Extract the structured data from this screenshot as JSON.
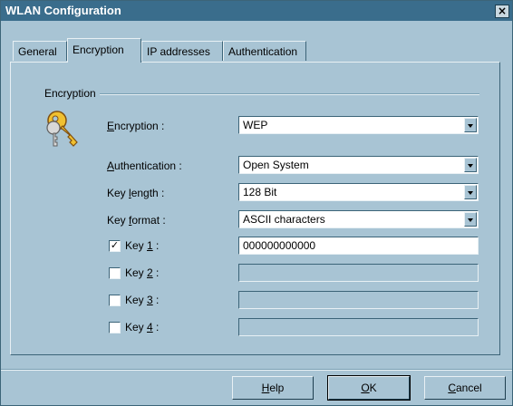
{
  "window": {
    "title": "WLAN Configuration",
    "close_glyph": "×"
  },
  "tabs": [
    {
      "label": "General",
      "active": false
    },
    {
      "label": "Encryption",
      "active": true
    },
    {
      "label": "IP addresses",
      "active": false
    },
    {
      "label": "Authentication",
      "active": false
    }
  ],
  "group": {
    "label": "Encryption",
    "icon": "keys-icon"
  },
  "fields": {
    "encryption": {
      "label_pre": "",
      "label_ul": "E",
      "label_post": "ncryption :",
      "value": "WEP"
    },
    "authentication": {
      "label_pre": "",
      "label_ul": "A",
      "label_post": "uthentication :",
      "value": "Open System"
    },
    "key_length": {
      "label_pre": "Key ",
      "label_ul": "l",
      "label_post": "ength :",
      "value": "128 Bit"
    },
    "key_format": {
      "label_pre": "Key ",
      "label_ul": "f",
      "label_post": "ormat :",
      "value": "ASCII characters"
    }
  },
  "keys": [
    {
      "label_pre": "Key ",
      "label_ul": "1",
      "label_post": " :",
      "checked": true,
      "check_glyph": "✓",
      "value": "000000000000"
    },
    {
      "label_pre": "Key ",
      "label_ul": "2",
      "label_post": " :",
      "checked": false,
      "check_glyph": "",
      "value": ""
    },
    {
      "label_pre": "Key ",
      "label_ul": "3",
      "label_post": " :",
      "checked": false,
      "check_glyph": "",
      "value": ""
    },
    {
      "label_pre": "Key ",
      "label_ul": "4",
      "label_post": " :",
      "checked": false,
      "check_glyph": "",
      "value": ""
    }
  ],
  "buttons": {
    "help": {
      "pre": "",
      "ul": "H",
      "post": "elp"
    },
    "ok": {
      "pre": "",
      "ul": "O",
      "post": "K"
    },
    "cancel": {
      "pre": "",
      "ul": "C",
      "post": "ancel"
    }
  },
  "colors": {
    "window_bg": "#a8c4d4",
    "titlebar": "#3a6d8c"
  }
}
